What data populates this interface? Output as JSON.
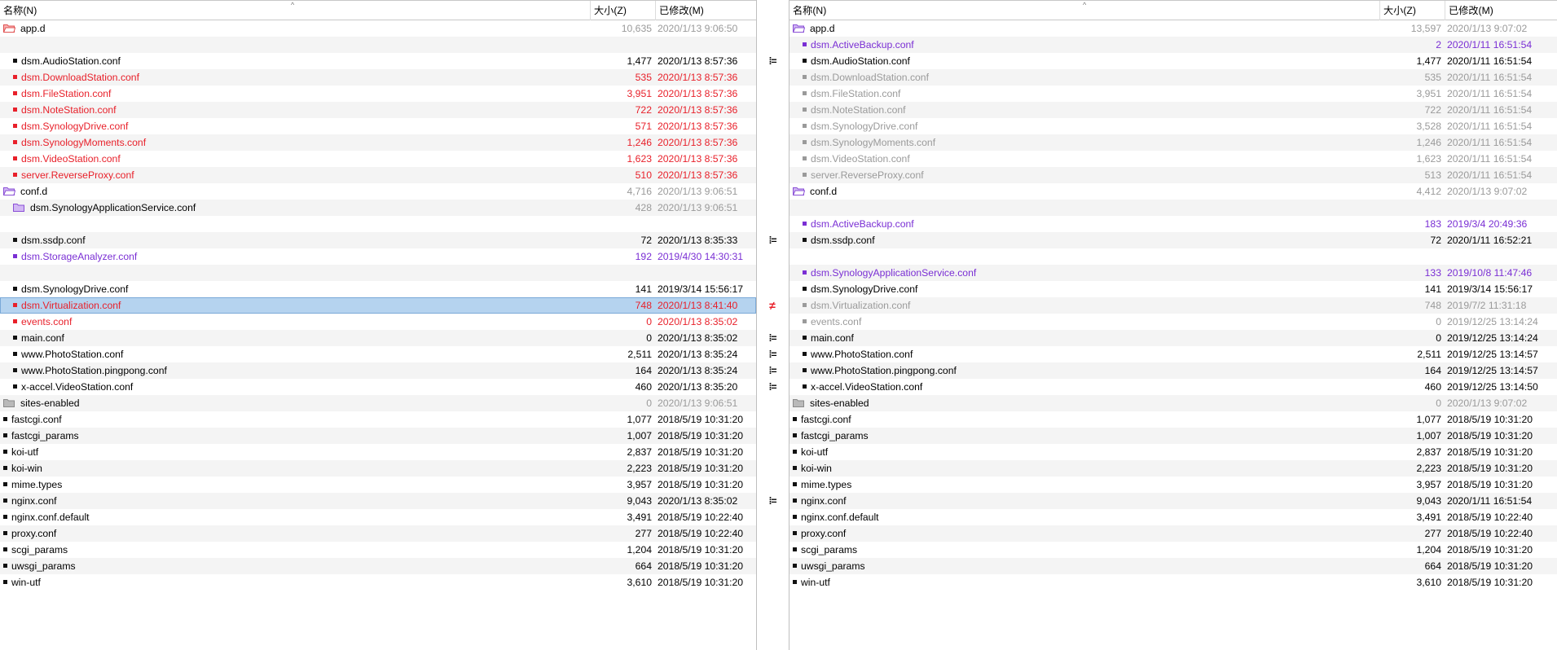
{
  "header": {
    "name_col": "名称(N)",
    "size_col": "大小(Z)",
    "modified_col": "已修改(M)"
  },
  "colors": {
    "diff_red": "#e8202a",
    "orphan_purple": "#7a2fd4",
    "muted_gray": "#9a9a9a",
    "selection_blue": "#b5d3ef"
  },
  "compare_marks": [
    "",
    "",
    "eq",
    "",
    "",
    "",
    "",
    "",
    "",
    "",
    "",
    "",
    "",
    "eq",
    "",
    "",
    "",
    "ne",
    "",
    "eq",
    "eq",
    "eq",
    "eq",
    "",
    "",
    "",
    "",
    "",
    "",
    "eq",
    "",
    "",
    "",
    "",
    "",
    ""
  ],
  "left_rows": [
    {
      "name": "app.d",
      "size": "10,635",
      "date": "2020/1/13 9:06:50",
      "indent": 0,
      "kind": "folder-open-red",
      "color": "normal",
      "meta": "gray"
    },
    {
      "blank": true
    },
    {
      "name": "dsm.AudioStation.conf",
      "size": "1,477",
      "date": "2020/1/13 8:57:36",
      "indent": 1,
      "kind": "file",
      "color": "normal"
    },
    {
      "name": "dsm.DownloadStation.conf",
      "size": "535",
      "date": "2020/1/13 8:57:36",
      "indent": 1,
      "kind": "file",
      "color": "red"
    },
    {
      "name": "dsm.FileStation.conf",
      "size": "3,951",
      "date": "2020/1/13 8:57:36",
      "indent": 1,
      "kind": "file",
      "color": "red"
    },
    {
      "name": "dsm.NoteStation.conf",
      "size": "722",
      "date": "2020/1/13 8:57:36",
      "indent": 1,
      "kind": "file",
      "color": "red"
    },
    {
      "name": "dsm.SynologyDrive.conf",
      "size": "571",
      "date": "2020/1/13 8:57:36",
      "indent": 1,
      "kind": "file",
      "color": "red"
    },
    {
      "name": "dsm.SynologyMoments.conf",
      "size": "1,246",
      "date": "2020/1/13 8:57:36",
      "indent": 1,
      "kind": "file",
      "color": "red"
    },
    {
      "name": "dsm.VideoStation.conf",
      "size": "1,623",
      "date": "2020/1/13 8:57:36",
      "indent": 1,
      "kind": "file",
      "color": "red"
    },
    {
      "name": "server.ReverseProxy.conf",
      "size": "510",
      "date": "2020/1/13 8:57:36",
      "indent": 1,
      "kind": "file",
      "color": "red"
    },
    {
      "name": "conf.d",
      "size": "4,716",
      "date": "2020/1/13 9:06:51",
      "indent": 0,
      "kind": "folder-open-purple",
      "color": "normal",
      "meta": "gray"
    },
    {
      "name": "dsm.SynologyApplicationService.conf",
      "size": "428",
      "date": "2020/1/13 9:06:51",
      "indent": 1,
      "kind": "folder-purple",
      "color": "normal",
      "meta": "gray"
    },
    {
      "blank": true
    },
    {
      "name": "dsm.ssdp.conf",
      "size": "72",
      "date": "2020/1/13 8:35:33",
      "indent": 1,
      "kind": "file",
      "color": "normal"
    },
    {
      "name": "dsm.StorageAnalyzer.conf",
      "size": "192",
      "date": "2019/4/30 14:30:31",
      "indent": 1,
      "kind": "file",
      "color": "purple"
    },
    {
      "blank": true
    },
    {
      "name": "dsm.SynologyDrive.conf",
      "size": "141",
      "date": "2019/3/14 15:56:17",
      "indent": 1,
      "kind": "file",
      "color": "normal"
    },
    {
      "name": "dsm.Virtualization.conf",
      "size": "748",
      "date": "2020/1/13 8:41:40",
      "indent": 1,
      "kind": "file",
      "color": "red",
      "selected": true
    },
    {
      "name": "events.conf",
      "size": "0",
      "date": "2020/1/13 8:35:02",
      "indent": 1,
      "kind": "file",
      "color": "red"
    },
    {
      "name": "main.conf",
      "size": "0",
      "date": "2020/1/13 8:35:02",
      "indent": 1,
      "kind": "file",
      "color": "normal"
    },
    {
      "name": "www.PhotoStation.conf",
      "size": "2,511",
      "date": "2020/1/13 8:35:24",
      "indent": 1,
      "kind": "file",
      "color": "normal"
    },
    {
      "name": "www.PhotoStation.pingpong.conf",
      "size": "164",
      "date": "2020/1/13 8:35:24",
      "indent": 1,
      "kind": "file",
      "color": "normal"
    },
    {
      "name": "x-accel.VideoStation.conf",
      "size": "460",
      "date": "2020/1/13 8:35:20",
      "indent": 1,
      "kind": "file",
      "color": "normal"
    },
    {
      "name": "sites-enabled",
      "size": "0",
      "date": "2020/1/13 9:06:51",
      "indent": 0,
      "kind": "folder-gray",
      "color": "normal",
      "meta": "gray"
    },
    {
      "name": "fastcgi.conf",
      "size": "1,077",
      "date": "2018/5/19 10:31:20",
      "indent": 0,
      "kind": "file",
      "color": "normal"
    },
    {
      "name": "fastcgi_params",
      "size": "1,007",
      "date": "2018/5/19 10:31:20",
      "indent": 0,
      "kind": "file",
      "color": "normal"
    },
    {
      "name": "koi-utf",
      "size": "2,837",
      "date": "2018/5/19 10:31:20",
      "indent": 0,
      "kind": "file",
      "color": "normal"
    },
    {
      "name": "koi-win",
      "size": "2,223",
      "date": "2018/5/19 10:31:20",
      "indent": 0,
      "kind": "file",
      "color": "normal"
    },
    {
      "name": "mime.types",
      "size": "3,957",
      "date": "2018/5/19 10:31:20",
      "indent": 0,
      "kind": "file",
      "color": "normal"
    },
    {
      "name": "nginx.conf",
      "size": "9,043",
      "date": "2020/1/13 8:35:02",
      "indent": 0,
      "kind": "file",
      "color": "normal"
    },
    {
      "name": "nginx.conf.default",
      "size": "3,491",
      "date": "2018/5/19 10:22:40",
      "indent": 0,
      "kind": "file",
      "color": "normal"
    },
    {
      "name": "proxy.conf",
      "size": "277",
      "date": "2018/5/19 10:22:40",
      "indent": 0,
      "kind": "file",
      "color": "normal"
    },
    {
      "name": "scgi_params",
      "size": "1,204",
      "date": "2018/5/19 10:31:20",
      "indent": 0,
      "kind": "file",
      "color": "normal"
    },
    {
      "name": "uwsgi_params",
      "size": "664",
      "date": "2018/5/19 10:31:20",
      "indent": 0,
      "kind": "file",
      "color": "normal"
    },
    {
      "name": "win-utf",
      "size": "3,610",
      "date": "2018/5/19 10:31:20",
      "indent": 0,
      "kind": "file",
      "color": "normal"
    }
  ],
  "right_rows": [
    {
      "name": "app.d",
      "size": "13,597",
      "date": "2020/1/13 9:07:02",
      "indent": 0,
      "kind": "folder-open-purple",
      "color": "normal",
      "meta": "gray"
    },
    {
      "name": "dsm.ActiveBackup.conf",
      "size": "2",
      "date": "2020/1/11 16:51:54",
      "indent": 1,
      "kind": "file",
      "color": "purple"
    },
    {
      "name": "dsm.AudioStation.conf",
      "size": "1,477",
      "date": "2020/1/11 16:51:54",
      "indent": 1,
      "kind": "file",
      "color": "normal"
    },
    {
      "name": "dsm.DownloadStation.conf",
      "size": "535",
      "date": "2020/1/11 16:51:54",
      "indent": 1,
      "kind": "file",
      "color": "gray"
    },
    {
      "name": "dsm.FileStation.conf",
      "size": "3,951",
      "date": "2020/1/11 16:51:54",
      "indent": 1,
      "kind": "file",
      "color": "gray"
    },
    {
      "name": "dsm.NoteStation.conf",
      "size": "722",
      "date": "2020/1/11 16:51:54",
      "indent": 1,
      "kind": "file",
      "color": "gray"
    },
    {
      "name": "dsm.SynologyDrive.conf",
      "size": "3,528",
      "date": "2020/1/11 16:51:54",
      "indent": 1,
      "kind": "file",
      "color": "gray"
    },
    {
      "name": "dsm.SynologyMoments.conf",
      "size": "1,246",
      "date": "2020/1/11 16:51:54",
      "indent": 1,
      "kind": "file",
      "color": "gray"
    },
    {
      "name": "dsm.VideoStation.conf",
      "size": "1,623",
      "date": "2020/1/11 16:51:54",
      "indent": 1,
      "kind": "file",
      "color": "gray"
    },
    {
      "name": "server.ReverseProxy.conf",
      "size": "513",
      "date": "2020/1/11 16:51:54",
      "indent": 1,
      "kind": "file",
      "color": "gray"
    },
    {
      "name": "conf.d",
      "size": "4,412",
      "date": "2020/1/13 9:07:02",
      "indent": 0,
      "kind": "folder-open-purple",
      "color": "normal",
      "meta": "gray"
    },
    {
      "blank": true
    },
    {
      "name": "dsm.ActiveBackup.conf",
      "size": "183",
      "date": "2019/3/4 20:49:36",
      "indent": 1,
      "kind": "file",
      "color": "purple"
    },
    {
      "name": "dsm.ssdp.conf",
      "size": "72",
      "date": "2020/1/11 16:52:21",
      "indent": 1,
      "kind": "file",
      "color": "normal"
    },
    {
      "blank": true
    },
    {
      "name": "dsm.SynologyApplicationService.conf",
      "size": "133",
      "date": "2019/10/8 11:47:46",
      "indent": 1,
      "kind": "file",
      "color": "purple"
    },
    {
      "name": "dsm.SynologyDrive.conf",
      "size": "141",
      "date": "2019/3/14 15:56:17",
      "indent": 1,
      "kind": "file",
      "color": "normal"
    },
    {
      "name": "dsm.Virtualization.conf",
      "size": "748",
      "date": "2019/7/2 11:31:18",
      "indent": 1,
      "kind": "file",
      "color": "gray"
    },
    {
      "name": "events.conf",
      "size": "0",
      "date": "2019/12/25 13:14:24",
      "indent": 1,
      "kind": "file",
      "color": "gray"
    },
    {
      "name": "main.conf",
      "size": "0",
      "date": "2019/12/25 13:14:24",
      "indent": 1,
      "kind": "file",
      "color": "normal"
    },
    {
      "name": "www.PhotoStation.conf",
      "size": "2,511",
      "date": "2019/12/25 13:14:57",
      "indent": 1,
      "kind": "file",
      "color": "normal"
    },
    {
      "name": "www.PhotoStation.pingpong.conf",
      "size": "164",
      "date": "2019/12/25 13:14:57",
      "indent": 1,
      "kind": "file",
      "color": "normal"
    },
    {
      "name": "x-accel.VideoStation.conf",
      "size": "460",
      "date": "2019/12/25 13:14:50",
      "indent": 1,
      "kind": "file",
      "color": "normal"
    },
    {
      "name": "sites-enabled",
      "size": "0",
      "date": "2020/1/13 9:07:02",
      "indent": 0,
      "kind": "folder-gray",
      "color": "normal",
      "meta": "gray"
    },
    {
      "name": "fastcgi.conf",
      "size": "1,077",
      "date": "2018/5/19 10:31:20",
      "indent": 0,
      "kind": "file",
      "color": "normal"
    },
    {
      "name": "fastcgi_params",
      "size": "1,007",
      "date": "2018/5/19 10:31:20",
      "indent": 0,
      "kind": "file",
      "color": "normal"
    },
    {
      "name": "koi-utf",
      "size": "2,837",
      "date": "2018/5/19 10:31:20",
      "indent": 0,
      "kind": "file",
      "color": "normal"
    },
    {
      "name": "koi-win",
      "size": "2,223",
      "date": "2018/5/19 10:31:20",
      "indent": 0,
      "kind": "file",
      "color": "normal"
    },
    {
      "name": "mime.types",
      "size": "3,957",
      "date": "2018/5/19 10:31:20",
      "indent": 0,
      "kind": "file",
      "color": "normal"
    },
    {
      "name": "nginx.conf",
      "size": "9,043",
      "date": "2020/1/11 16:51:54",
      "indent": 0,
      "kind": "file",
      "color": "normal"
    },
    {
      "name": "nginx.conf.default",
      "size": "3,491",
      "date": "2018/5/19 10:22:40",
      "indent": 0,
      "kind": "file",
      "color": "normal"
    },
    {
      "name": "proxy.conf",
      "size": "277",
      "date": "2018/5/19 10:22:40",
      "indent": 0,
      "kind": "file",
      "color": "normal"
    },
    {
      "name": "scgi_params",
      "size": "1,204",
      "date": "2018/5/19 10:31:20",
      "indent": 0,
      "kind": "file",
      "color": "normal"
    },
    {
      "name": "uwsgi_params",
      "size": "664",
      "date": "2018/5/19 10:31:20",
      "indent": 0,
      "kind": "file",
      "color": "normal"
    },
    {
      "name": "win-utf",
      "size": "3,610",
      "date": "2018/5/19 10:31:20",
      "indent": 0,
      "kind": "file",
      "color": "normal"
    }
  ]
}
